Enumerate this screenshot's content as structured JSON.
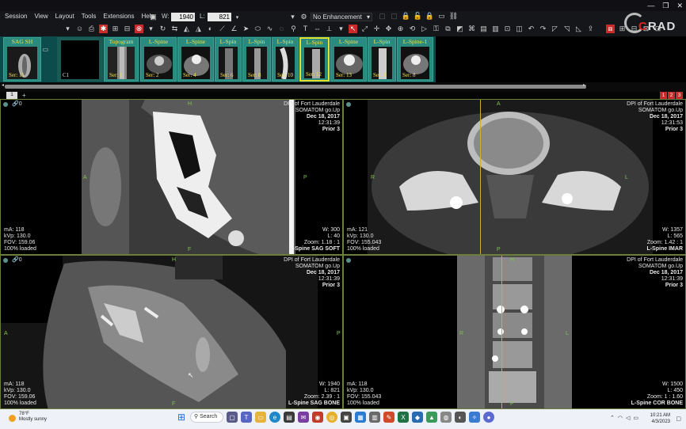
{
  "menu": [
    "Session",
    "View",
    "Layout",
    "Tools",
    "Extensions",
    "Help"
  ],
  "window_level": {
    "w_label": "W:",
    "w_value": "1940",
    "l_label": "L:",
    "l_value": "821"
  },
  "enhancement": "No Enhancement",
  "logo": {
    "c": "C",
    "rad": "RAD"
  },
  "series": [
    {
      "title": "SAG SH",
      "ser": "Ser: 11",
      "selected": false
    },
    {
      "title": "",
      "ser": "",
      "extra": "C1",
      "selected": false
    },
    {
      "title": "Topogram",
      "ser": "Ser: 1",
      "selected": false
    },
    {
      "title": "L-Spine",
      "ser": "Ser: 2",
      "selected": false
    },
    {
      "title": "L-Spine",
      "ser": "Ser: 4",
      "selected": false
    },
    {
      "title": "L-Spin",
      "ser": "Ser: 6",
      "selected": false
    },
    {
      "title": "L-Spin",
      "ser": "Ser: 8",
      "selected": false
    },
    {
      "title": "L-Spin",
      "ser": "Ser: 10",
      "selected": false
    },
    {
      "title": "L-Spin",
      "ser": "Ser: 12",
      "selected": true
    },
    {
      "title": "L-Spine",
      "ser": "Ser: 13",
      "selected": false
    },
    {
      "title": "L-Spin",
      "ser": "Ser: 3",
      "selected": false
    },
    {
      "title": "L-Spine-1",
      "ser": "Ser: 8",
      "selected": false
    }
  ],
  "tab_label": "1",
  "pages": [
    "1",
    "2",
    "3"
  ],
  "viewports": [
    {
      "facility": "DPI of Fort Lauderdale",
      "scanner": "SOMATOM go.Up",
      "date": "Dec 18, 2017",
      "time": "12:31:39",
      "prior": "Prior 3",
      "ma": "mA: 118",
      "kvp": "kVp: 130.0",
      "fov": "FOV: 159.06",
      "loaded": "100% loaded",
      "w": "W: 300",
      "l": "L: 40",
      "zoom": "Zoom: 1.18 : 1",
      "series_name": "L-Spine  SAG SOFT",
      "orient": {
        "top": "H",
        "left": "A",
        "right": "P",
        "bottom": "F"
      }
    },
    {
      "facility": "DPI of Fort Lauderdale",
      "scanner": "SOMATOM go.Up",
      "date": "Dec 18, 2017",
      "time": "12:31:53",
      "prior": "Prior 3",
      "ma": "mA: 121",
      "kvp": "kVp: 130.0",
      "fov": "FOV: 155.043",
      "loaded": "100% loaded",
      "w": "W: 1357",
      "l": "L: 565",
      "zoom": "Zoom: 1.42 : 1",
      "series_name": "L-Spine  IMAR",
      "orient": {
        "top": "A",
        "left": "R",
        "right": "L",
        "bottom": "P"
      }
    },
    {
      "facility": "DPI of Fort Lauderdale",
      "scanner": "SOMATOM go.Up",
      "date": "Dec 18, 2017",
      "time": "12:31:39",
      "prior": "Prior 3",
      "ma": "mA: 118",
      "kvp": "kVp: 130.0",
      "fov": "FOV: 159.06",
      "loaded": "100% loaded",
      "w": "W: 1940",
      "l": "L: 821",
      "zoom": "Zoom: 2.39 : 1",
      "series_name": "L-Spine  SAG BONE",
      "orient": {
        "top": "H",
        "left": "A",
        "right": "P",
        "bottom": "F"
      }
    },
    {
      "facility": "DPI of Fort Lauderdale",
      "scanner": "SOMATOM go.Up",
      "date": "Dec 18, 2017",
      "time": "12:31:39",
      "prior": "Prior 3",
      "ma": "mA: 118",
      "kvp": "kVp: 130.0",
      "fov": "FOV: 155.043",
      "loaded": "100% loaded",
      "w": "W: 1500",
      "l": "L: 450",
      "zoom": "Zoom: 1 : 1.60",
      "series_name": "L-Spine  COR BONE",
      "orient": {
        "top": "H",
        "left": "R",
        "right": "L",
        "bottom": "F"
      }
    }
  ],
  "taskbar": {
    "weather_temp": "78°F",
    "weather_desc": "Mostly sunny",
    "search": "Search",
    "time": "10:21 AM",
    "date": "4/3/2023"
  },
  "colors": {
    "accent_red": "#c92a2a",
    "overlay_green": "#7ec44a",
    "strip_teal": "#2b8a7e",
    "thumb_title": "#f2e24a"
  }
}
